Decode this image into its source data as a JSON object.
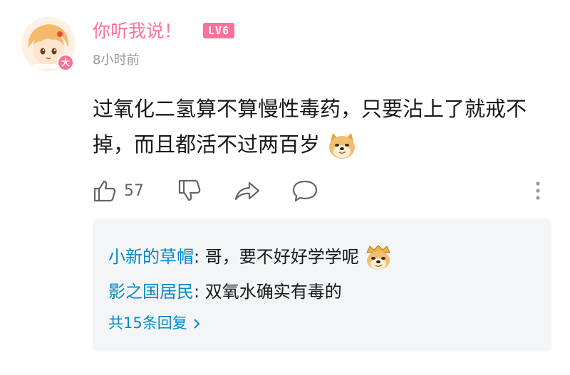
{
  "comment": {
    "username": "你听我说！",
    "level": "LV6",
    "avatar_badge": "大",
    "time": "8小时前",
    "text": "过氧化二氢算不算慢性毒药，只要沾上了就戒不掉，而且都活不过两百岁",
    "text_emoji": "doge-emoji",
    "like_count": "57",
    "actions": [
      "like-icon",
      "dislike-icon",
      "share-icon",
      "reply-icon",
      "more-icon"
    ]
  },
  "replies": {
    "items": [
      {
        "name": "小新的草帽",
        "separator": ": ",
        "text": "哥，要不好好学学呢",
        "emoji": "doge-king-emoji"
      },
      {
        "name": "影之国居民",
        "separator": ": ",
        "text": "双氧水确实有毒的"
      }
    ],
    "more_label": "共15条回复"
  },
  "colors": {
    "username": "#fb7299",
    "level_badge": "#fb7299",
    "reply_name": "#008ac5",
    "muted": "#9499a0",
    "reply_bg": "#f4f5f7"
  }
}
